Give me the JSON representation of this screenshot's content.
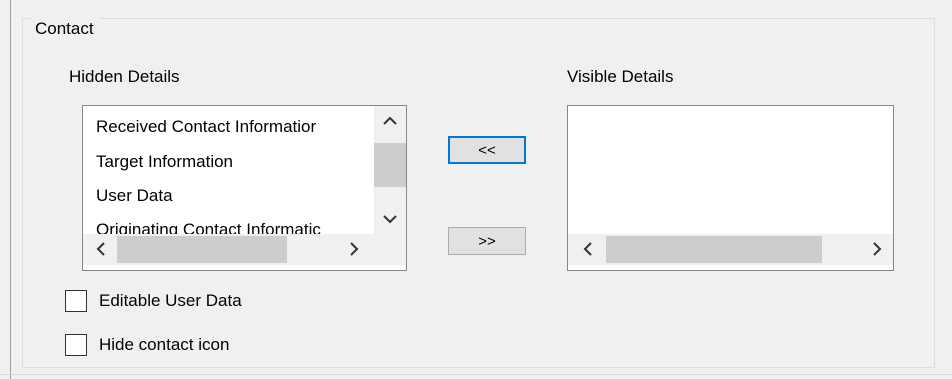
{
  "group": {
    "title": "Contact"
  },
  "hidden": {
    "label": "Hidden Details",
    "items": [
      "Received Contact Informatior",
      "Target Information",
      "User Data",
      "Originating Contact Informatic"
    ]
  },
  "visible": {
    "label": "Visible Details",
    "items": []
  },
  "buttons": {
    "move_to_hidden": "<<",
    "move_to_visible": ">>"
  },
  "options": {
    "editable_user_data": {
      "label": "Editable User Data",
      "checked": false
    },
    "hide_contact_icon": {
      "label": "Hide contact icon",
      "checked": false
    }
  }
}
